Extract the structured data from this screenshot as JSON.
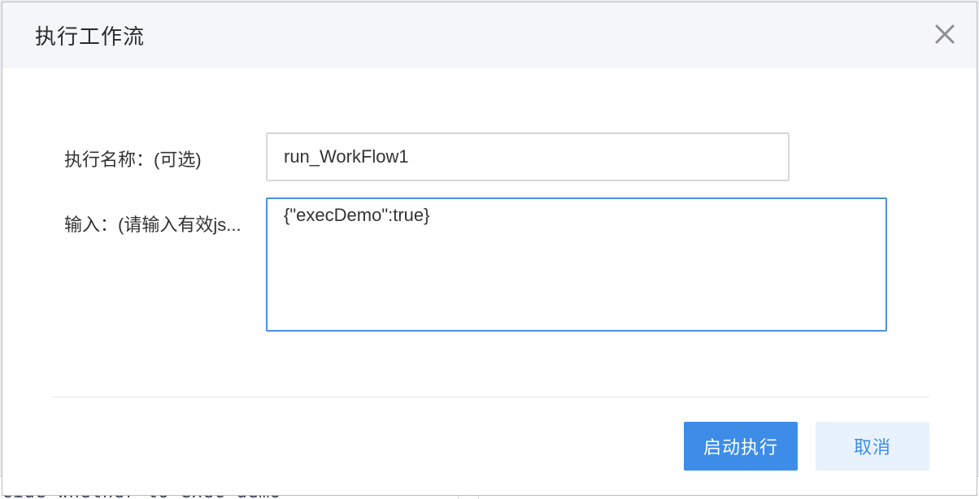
{
  "background": {
    "code_snippet": "cide whether to exec demo"
  },
  "dialog": {
    "title": "执行工作流",
    "close_icon": "close-icon",
    "fields": {
      "name": {
        "label": "执行名称：(可选)",
        "value": "run_WorkFlow1"
      },
      "input": {
        "label": "输入：(请输入有效js...",
        "value": "{\"execDemo\":true}"
      }
    },
    "buttons": {
      "start": "启动执行",
      "cancel": "取消"
    }
  },
  "colors": {
    "primary": "#3d8de8",
    "secondary_bg": "#e8f2fd",
    "focus_border": "#4a90e2",
    "header_bg": "#f4f6f9"
  }
}
